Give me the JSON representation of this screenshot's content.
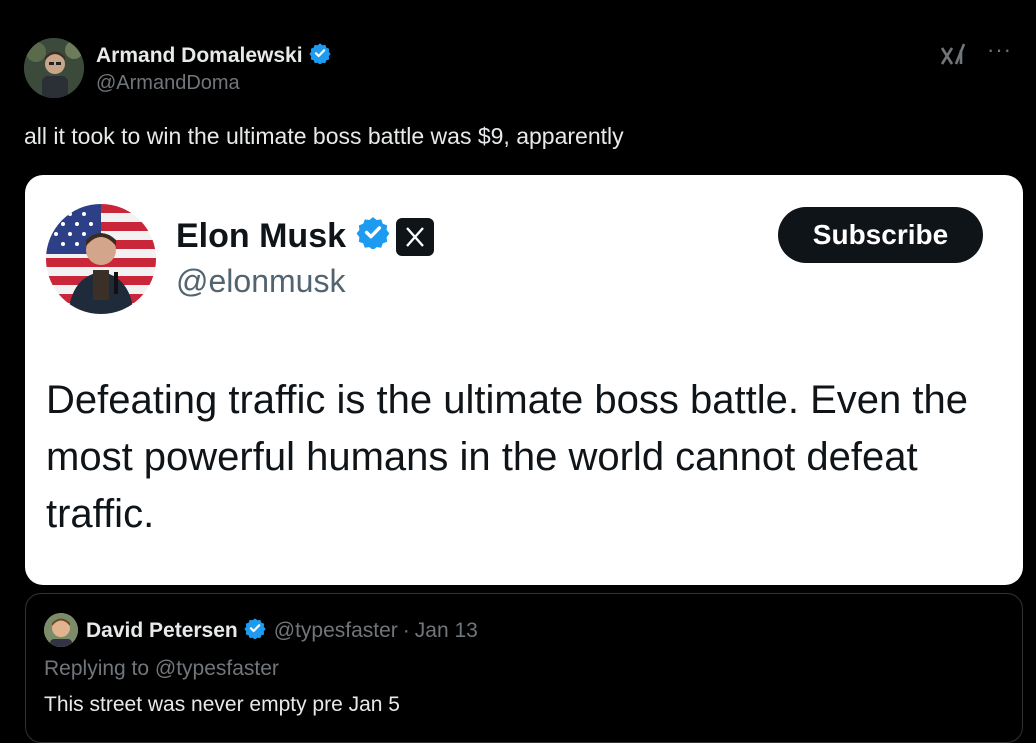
{
  "post": {
    "author_name": "Armand Domalewski",
    "author_handle": "@ArmandDoma",
    "text": "all it took to win the ultimate boss battle was $9, apparently",
    "more_label": "···"
  },
  "embedded_image": {
    "name": "Elon Musk",
    "handle": "@elonmusk",
    "subscribe_label": "Subscribe",
    "text": "Defeating traffic is the ultimate boss battle. Even the most powerful humans in the world cannot defeat traffic."
  },
  "quoted_post": {
    "author_name": "David Petersen",
    "author_handle": "@typesfaster",
    "separator": "·",
    "date": "Jan 13",
    "replying_to": "Replying to @typesfaster",
    "text": "This street was never empty pre Jan 5"
  },
  "colors": {
    "background": "#000000",
    "verified_blue": "#1d9bf0",
    "secondary_text": "#71767b"
  },
  "icons": [
    "verified-badge-icon",
    "grok-icon",
    "more-icon",
    "x-logo-icon"
  ]
}
